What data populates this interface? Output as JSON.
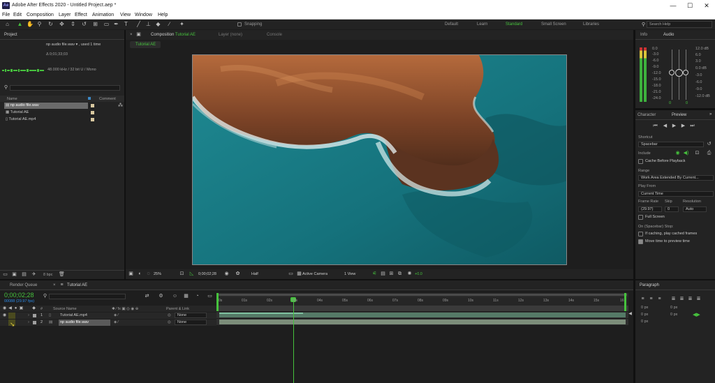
{
  "app": {
    "title": "Adobe After Effects 2020 - Untitled Project.aep *",
    "logo": "Ae",
    "window_controls": [
      "—",
      "☐",
      "✕"
    ]
  },
  "menu": [
    "File",
    "Edit",
    "Composition",
    "Layer",
    "Effect",
    "Animation",
    "View",
    "Window",
    "Help"
  ],
  "toolbar": {
    "snapping_label": "Snapping",
    "workspaces": [
      "Default",
      "Learn",
      "Standard",
      "Small Screen",
      "Libraries"
    ],
    "active_workspace": "Standard",
    "search_placeholder": "Search Help"
  },
  "project": {
    "tab": "Project",
    "selected_name": "np audio file.wav ▾ , used 1 time",
    "duration": "Δ 0;01;33;03",
    "audio_info": "48.000 kHz / 32 bit U / Mono",
    "col_name": "Name",
    "col_comment": "Comment",
    "items": [
      {
        "name": "np audio file.wav",
        "selected": true
      },
      {
        "name": "Tutorial AE",
        "selected": false
      },
      {
        "name": "Tutorial AE.mp4",
        "selected": false
      }
    ],
    "bpc": "8 bpc"
  },
  "viewer": {
    "tabs": [
      "Composition Tutorial AE",
      "Layer (none)",
      "Console"
    ],
    "comp_tab_prefix": "Composition",
    "comp_tab_name": "Tutorial AE",
    "subtab": "Tutorial AE",
    "zoom": "25%",
    "timecode": "0;00;02;28",
    "resolution": "Half",
    "camera": "Active Camera",
    "views": "1 View",
    "exposure": "+0.0"
  },
  "info_audio": {
    "tabs": [
      "Info",
      "Audio"
    ],
    "left_scale": [
      "0.0",
      "-3.0",
      "-6.0",
      "-9.0",
      "-12.0",
      "-15.0",
      "-18.0",
      "-21.0",
      "-24.0"
    ],
    "right_scale": [
      "12.0 dB",
      "6.0",
      "3.0",
      "0.0 dB",
      "-3.0",
      "-6.0",
      "-9.0",
      "-12.0 dB"
    ],
    "left_val": "0",
    "right_val": "0"
  },
  "preview": {
    "tabs": [
      "Character",
      "Preview"
    ],
    "shortcut_label": "Shortcut",
    "shortcut_value": "Spacebar",
    "include_label": "Include",
    "cache_label": "Cache Before Playback",
    "range_label": "Range",
    "range_value": "Work Area Extended By Current...",
    "play_from_label": "Play From",
    "play_from_value": "Current Time",
    "frame_rate_label": "Frame Rate",
    "skip_label": "Skip",
    "resolution_label": "Resolution",
    "frame_rate_value": "(29.97)",
    "skip_value": "0",
    "resolution_value": "Auto",
    "full_screen_label": "Full Screen",
    "on_stop_label": "On (Spacebar) Stop:",
    "if_caching_label": "If caching, play cached frames",
    "move_time_label": "Move time to preview time"
  },
  "paragraph": {
    "tab": "Paragraph",
    "fields": [
      "0 px",
      "0 px",
      "0 px",
      "0 px",
      "0 px"
    ]
  },
  "timeline": {
    "tabs": [
      "Render Queue",
      "Tutorial AE"
    ],
    "current_time": "0;00;02;28",
    "fps_info": "00088 (29.97 fps)",
    "col_source": "Source Name",
    "col_parent": "Parent & Link",
    "ruler": [
      "0s",
      "01s",
      "02s",
      "03s",
      "04s",
      "05s",
      "06s",
      "07s",
      "08s",
      "09s",
      "10s",
      "11s",
      "12s",
      "13s",
      "14s",
      "15s",
      "16"
    ],
    "layers": [
      {
        "num": "1",
        "name": "Tutorial AE.mp4",
        "parent": "None"
      },
      {
        "num": "2",
        "name": "np audio file.wav",
        "parent": "None"
      }
    ]
  },
  "colors": {
    "accent_green": "#46c23d",
    "accent_blue": "#2d8ceb",
    "panel_bg": "#232323",
    "titlebar_bg": "#ffffff"
  }
}
